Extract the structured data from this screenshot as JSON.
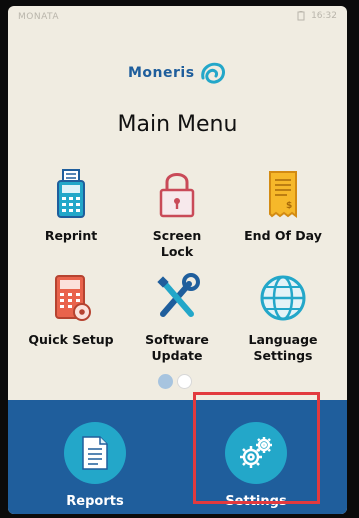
{
  "status": {
    "left": "MONATA",
    "time": "16:32"
  },
  "brand": "Moneris",
  "title": "Main Menu",
  "tiles": [
    {
      "label1": "Reprint",
      "label2": ""
    },
    {
      "label1": "Screen",
      "label2": "Lock"
    },
    {
      "label1": "End Of Day",
      "label2": ""
    },
    {
      "label1": "Quick Setup",
      "label2": ""
    },
    {
      "label1": "Software",
      "label2": "Update"
    },
    {
      "label1": "Language",
      "label2": "Settings"
    }
  ],
  "pager": {
    "current": 1,
    "total": 2
  },
  "bottom": [
    {
      "label": "Reports",
      "icon": "document-icon"
    },
    {
      "label": "Settings",
      "icon": "gears-icon"
    }
  ],
  "colors": {
    "brand": "#1f5e9c",
    "accent": "#23a7c9",
    "highlight": "#e23a3f"
  }
}
